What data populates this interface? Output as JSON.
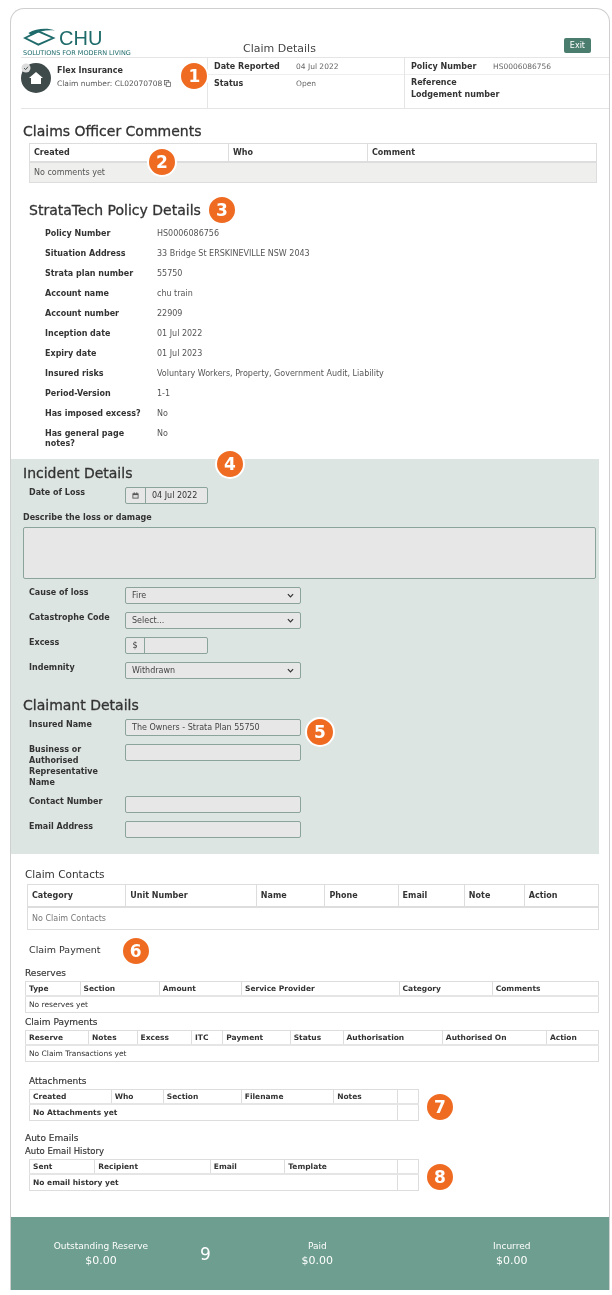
{
  "logo": {
    "name": "CHU",
    "tagline": "SOLUTIONS FOR MODERN LIVING"
  },
  "page_title": "Claim Details",
  "exit_button": "Exit",
  "claim_summary": {
    "insurer": "Flex Insurance",
    "claim_number": "Claim number: CL02070708",
    "annotation": "1",
    "fields": [
      {
        "label": "Date Reported",
        "value": "04 Jul 2022"
      },
      {
        "label": "Status",
        "value": "Open"
      },
      {
        "label": "Policy Number",
        "value": "HS0006086756"
      },
      {
        "label": "Reference"
      },
      {
        "label": "Lodgement number"
      }
    ]
  },
  "officer_comments": {
    "title": "Claims Officer Comments",
    "annotation": "2",
    "columns": [
      "Created",
      "Who",
      "Comment"
    ],
    "empty": "No comments yet"
  },
  "policy_details": {
    "title": "StrataTech Policy Details",
    "annotation": "3",
    "rows": [
      {
        "label": "Policy Number",
        "value": "HS0006086756"
      },
      {
        "label": "Situation Address",
        "value": "33 Bridge St ERSKINEVILLE NSW 2043"
      },
      {
        "label": "Strata plan number",
        "value": "55750"
      },
      {
        "label": "Account name",
        "value": "chu train"
      },
      {
        "label": "Account number",
        "value": "22909"
      },
      {
        "label": "Inception date",
        "value": "01 Jul 2022"
      },
      {
        "label": "Expiry date",
        "value": "01 Jul 2023"
      },
      {
        "label": "Insured risks",
        "value": "Voluntary Workers, Property, Government Audit, Liability"
      },
      {
        "label": "Period-Version",
        "value": "1-1"
      },
      {
        "label": "Has imposed excess?",
        "value": "No"
      },
      {
        "label": "Has general page notes?",
        "value": "No"
      }
    ]
  },
  "incident_details": {
    "title": "Incident Details",
    "annotation": "4",
    "fields": [
      {
        "kind": "date",
        "label": "Date of Loss",
        "value": "04 Jul 2022"
      },
      {
        "kind": "textarea",
        "label": "Describe the loss or damage"
      },
      {
        "kind": "select",
        "label": "Cause of loss",
        "value": "Fire"
      },
      {
        "kind": "select",
        "label": "Catastrophe Code",
        "value": "Select..."
      },
      {
        "kind": "currency",
        "label": "Excess",
        "prefix": "$"
      },
      {
        "kind": "select",
        "label": "Indemnity",
        "value": "Withdrawn"
      }
    ]
  },
  "claimant_details": {
    "title": "Claimant Details",
    "annotation": "5",
    "fields": [
      {
        "kind": "text",
        "label": "Insured Name",
        "value": "The Owners - Strata Plan 55750"
      },
      {
        "kind": "text",
        "label": "Business or Authorised Representative Name"
      },
      {
        "kind": "text",
        "label": "Contact Number"
      },
      {
        "kind": "text",
        "label": "Email Address"
      }
    ]
  },
  "claim_contacts": {
    "title": "Claim Contacts",
    "columns": [
      "Category",
      "Unit Number",
      "Name",
      "Phone",
      "Email",
      "Note",
      "Action"
    ],
    "empty": "No Claim Contacts"
  },
  "claim_payment": {
    "title": "Claim Payment",
    "annotation": "6",
    "reserves": {
      "title": "Reserves",
      "columns": [
        "Type",
        "Section",
        "Amount",
        "Service Provider",
        "Category",
        "Comments"
      ],
      "empty": "No reserves yet"
    },
    "payments": {
      "title": "Claim Payments",
      "columns": [
        "Reserve",
        "Notes",
        "Excess",
        "ITC",
        "Payment",
        "Status",
        "Authorisation",
        "Authorised On",
        "Action"
      ],
      "empty": "No Claim Transactions yet"
    }
  },
  "attachments": {
    "title": "Attachments",
    "annotation": "7",
    "columns": [
      "Created",
      "Who",
      "Section",
      "Filename",
      "Notes"
    ],
    "empty": "No Attachments yet"
  },
  "auto_emails": {
    "title": "Auto Emails",
    "subtitle": "Auto Email History",
    "annotation": "8",
    "columns": [
      "Sent",
      "Recipient",
      "Email",
      "Template"
    ],
    "empty": "No email history yet"
  },
  "totals": {
    "annotation": "9",
    "items": [
      {
        "label": "Outstanding Reserve",
        "value": "$0.00"
      },
      {
        "label": "Paid",
        "value": "$0.00"
      },
      {
        "label": "Incurred",
        "value": "$0.00"
      }
    ]
  }
}
